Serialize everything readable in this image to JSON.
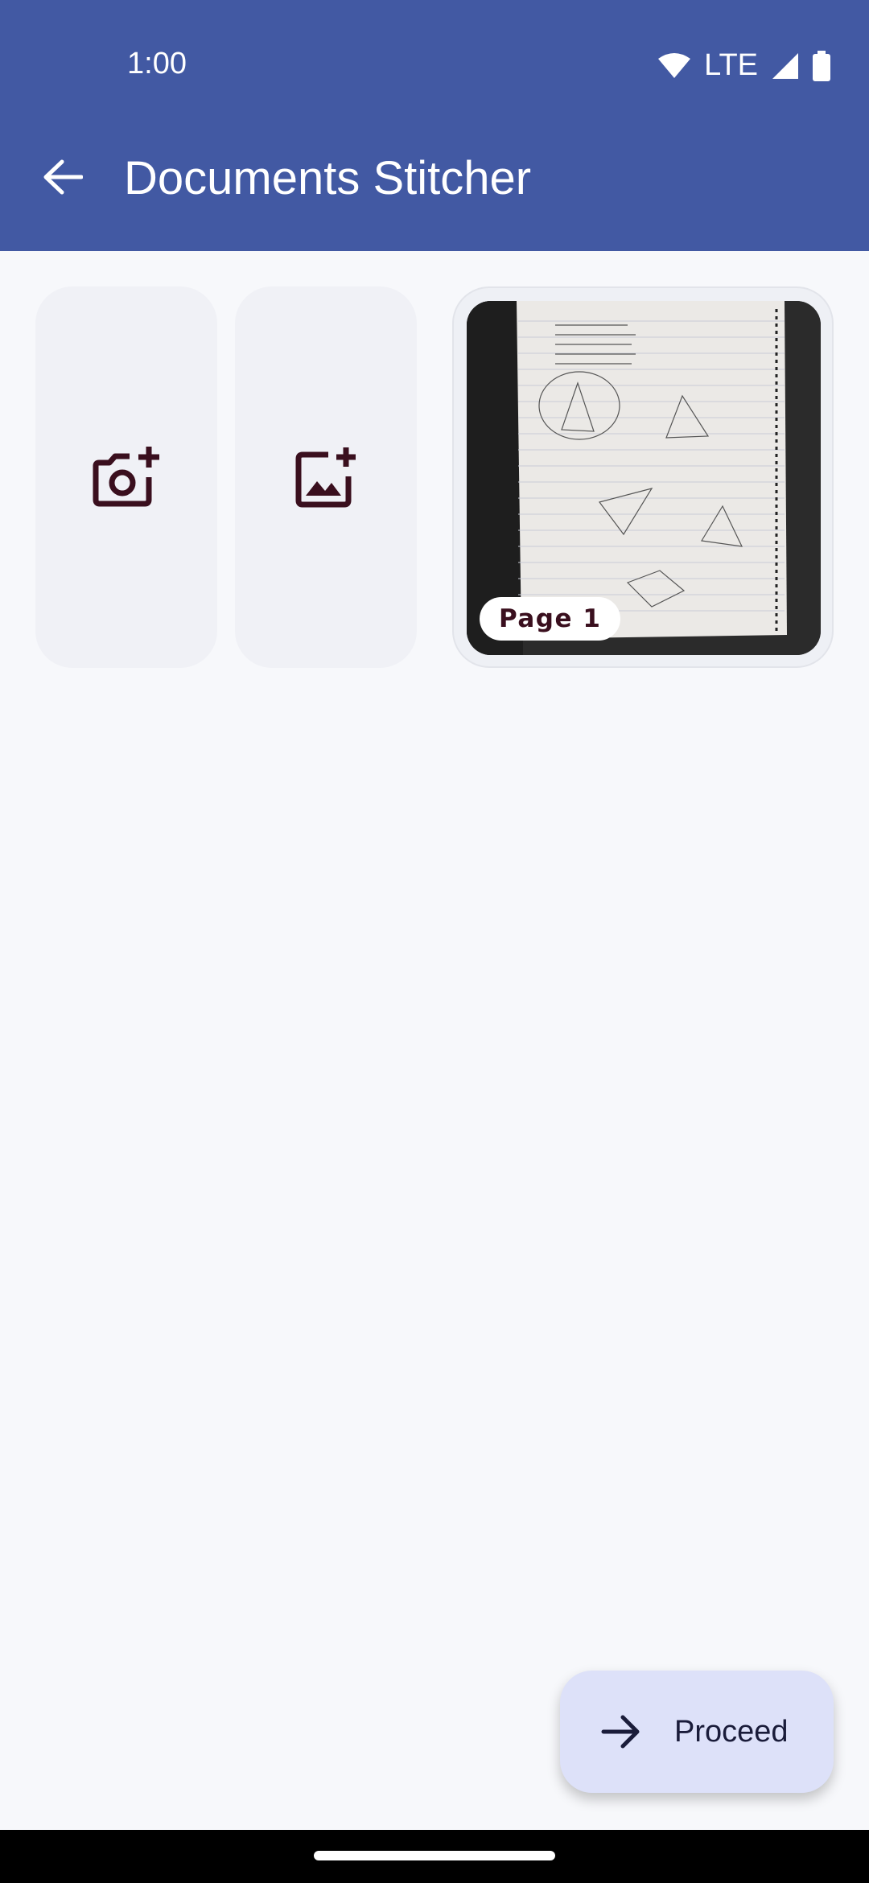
{
  "status_bar": {
    "time": "1:00",
    "network": "LTE"
  },
  "app_bar": {
    "title": "Documents Stitcher"
  },
  "tiles": {
    "camera_icon": "add-a-photo-icon",
    "gallery_icon": "add-photo-alternate-icon"
  },
  "pages": [
    {
      "label": "Page 1"
    }
  ],
  "fab": {
    "label": "Proceed",
    "icon": "arrow-forward-icon"
  },
  "colors": {
    "app_bar": "#4259a3",
    "fab": "#dde1f9",
    "icon_tint": "#3a0f1e"
  }
}
